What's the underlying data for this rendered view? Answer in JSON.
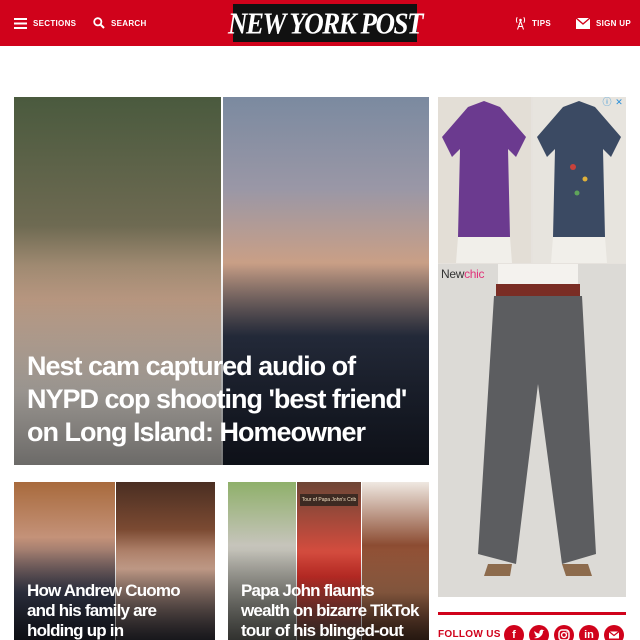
{
  "header": {
    "sections_label": "SECTIONS",
    "search_label": "SEARCH",
    "logo_text": "NEW YORK POST",
    "tips_label": "TIPS",
    "signup_label": "SIGN UP",
    "brand_color": "#d0021b"
  },
  "hero": {
    "headline": "Nest cam captured audio of NYPD cop shooting 'best friend' on Long Island: Homeowner"
  },
  "stories": [
    {
      "headline": "How Andrew Cuomo and his family are holding up in coronavirus quarantine"
    },
    {
      "headline": "Papa John flaunts wealth on bizarre TikTok tour of his blinged-out home",
      "photo_sign": "Tour of Papa John's Crib"
    }
  ],
  "ad": {
    "brand_prefix": "New",
    "brand_suffix": "chic",
    "info_icon": "info-icon",
    "close_icon": "close-icon"
  },
  "follow": {
    "label": "FOLLOW US",
    "icons": [
      "facebook-icon",
      "twitter-icon",
      "instagram-icon",
      "linkedin-icon",
      "email-icon"
    ]
  }
}
